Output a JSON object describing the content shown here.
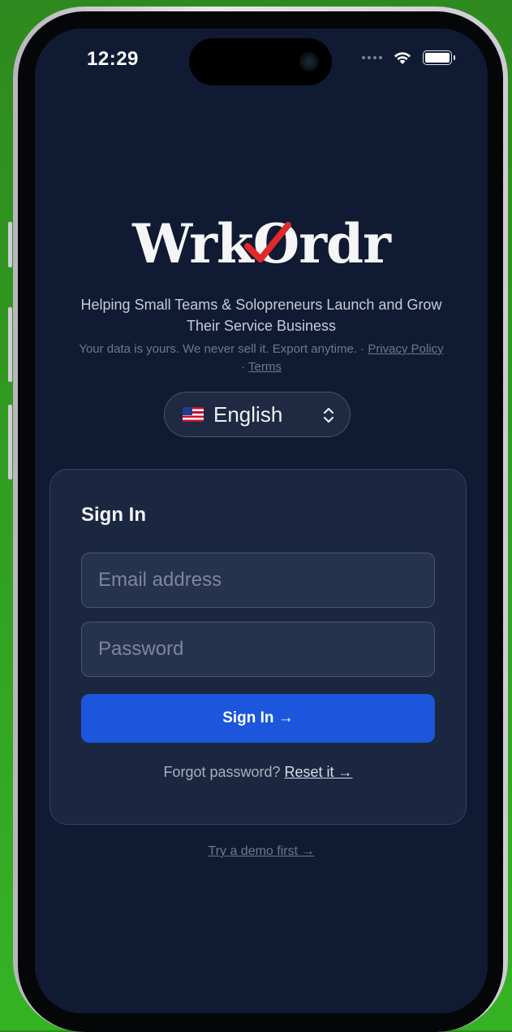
{
  "status_bar": {
    "time": "12:29",
    "wifi_icon": "wifi-icon",
    "battery_icon": "battery-icon"
  },
  "brand": {
    "logo_prefix": "Wrk",
    "logo_o": "O",
    "logo_suffix": "rdr",
    "check_color": "#e02a2a"
  },
  "tagline": "Helping Small Teams & Solopreneurs Launch and Grow Their Service Business",
  "privacy": {
    "text": "Your data is yours. We never sell it. Export anytime. · ",
    "privacy_link": "Privacy Policy",
    "separator": " · ",
    "terms_link": "Terms"
  },
  "language": {
    "flag_icon": "us-flag-icon",
    "selected": "English"
  },
  "sign_in_card": {
    "title": "Sign In",
    "email_placeholder": "Email address",
    "password_placeholder": "Password",
    "submit_label": "Sign In →",
    "forgot_text": "Forgot password? ",
    "reset_link": "Reset it →"
  },
  "demo_link": "Try a demo first →",
  "colors": {
    "background": "#101a33",
    "card": "#1b2740",
    "primary": "#1b56dc"
  }
}
